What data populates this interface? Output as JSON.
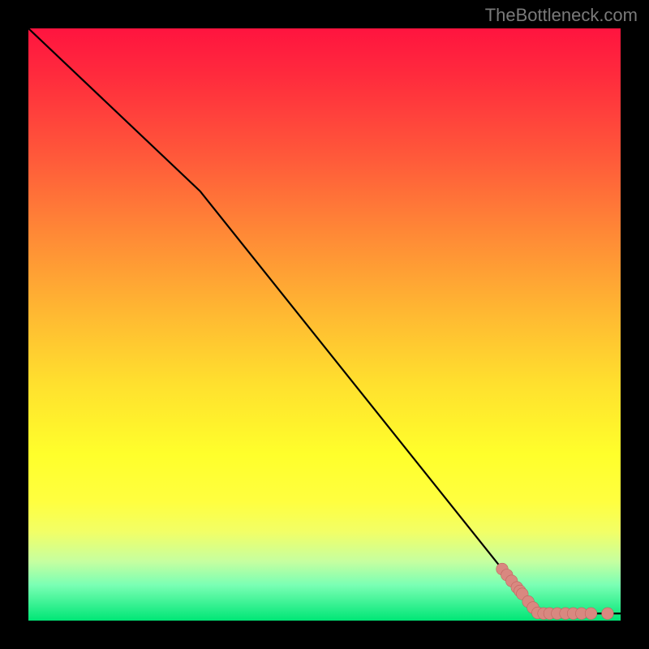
{
  "watermark": "TheBottleneck.com",
  "colors": {
    "line": "#000000",
    "marker_fill": "#d98880",
    "marker_stroke": "#c0645f",
    "frame": "#000000"
  },
  "chart_data": {
    "type": "line",
    "title": "",
    "xlabel": "",
    "ylabel": "",
    "xlim": [
      0,
      100
    ],
    "ylim": [
      0,
      100
    ],
    "line_points": [
      {
        "x": 0,
        "y": 100
      },
      {
        "x": 29,
        "y": 72.5
      },
      {
        "x": 86,
        "y": 1.2
      },
      {
        "x": 100,
        "y": 1.2
      }
    ],
    "scatter_points": [
      {
        "x": 80.0,
        "y": 8.7
      },
      {
        "x": 80.8,
        "y": 7.7
      },
      {
        "x": 81.6,
        "y": 6.7
      },
      {
        "x": 82.5,
        "y": 5.6
      },
      {
        "x": 83.0,
        "y": 5.0
      },
      {
        "x": 83.4,
        "y": 4.5
      },
      {
        "x": 84.4,
        "y": 3.2
      },
      {
        "x": 85.2,
        "y": 2.2
      },
      {
        "x": 86.0,
        "y": 1.3
      },
      {
        "x": 87.0,
        "y": 1.2
      },
      {
        "x": 88.0,
        "y": 1.2
      },
      {
        "x": 89.3,
        "y": 1.2
      },
      {
        "x": 90.7,
        "y": 1.2
      },
      {
        "x": 92.0,
        "y": 1.2
      },
      {
        "x": 93.4,
        "y": 1.2
      },
      {
        "x": 95.0,
        "y": 1.2
      },
      {
        "x": 97.8,
        "y": 1.2
      }
    ],
    "marker_radius": 1.0
  }
}
